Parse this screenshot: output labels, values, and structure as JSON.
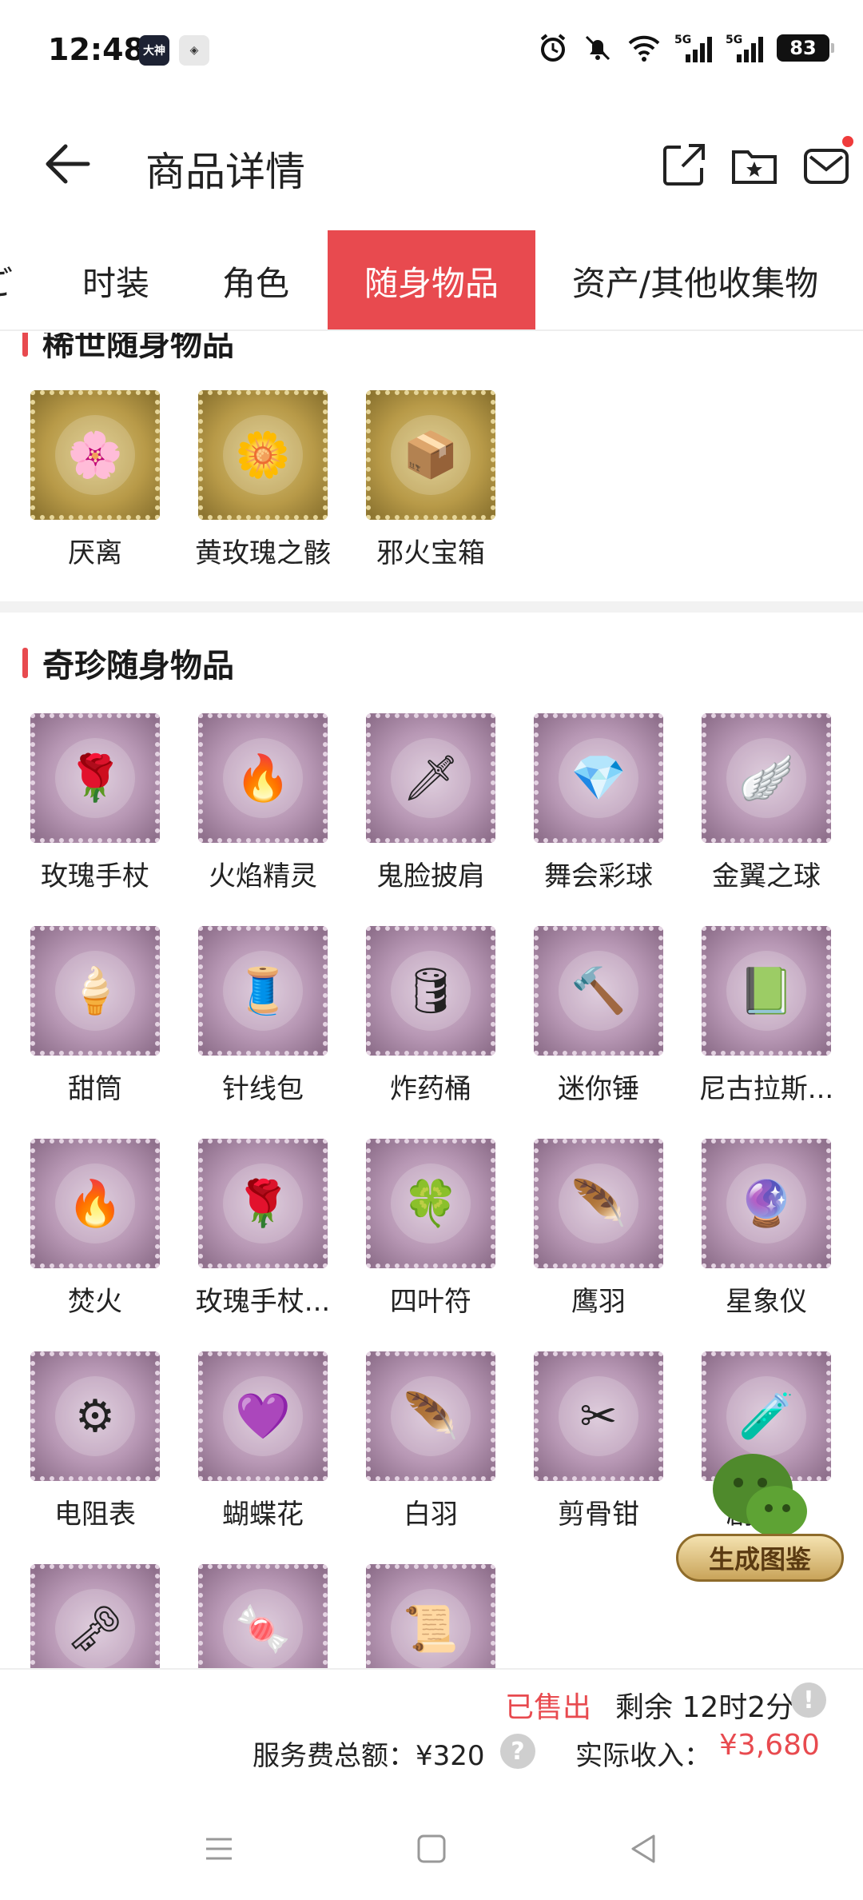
{
  "status_bar": {
    "time": "12:48",
    "app_icon_1": "大神",
    "app_icon_2": "◈",
    "battery": "83",
    "signal_1": "5G",
    "signal_2": "5G"
  },
  "header": {
    "title": "商品详情"
  },
  "tabs": [
    {
      "label": "ご",
      "active": false
    },
    {
      "label": "时装",
      "active": false
    },
    {
      "label": "角色",
      "active": false
    },
    {
      "label": "随身物品",
      "active": true
    },
    {
      "label": "资产/其他收集物",
      "active": false
    }
  ],
  "sections": {
    "rare": {
      "title": "稀世随身物品",
      "items": [
        {
          "name": "厌离",
          "emblem": "🌸"
        },
        {
          "name": "黄玫瑰之骸",
          "emblem": "🌼"
        },
        {
          "name": "邪火宝箱",
          "emblem": "📦"
        }
      ]
    },
    "precious": {
      "title": "奇珍随身物品",
      "items": [
        {
          "name": "玫瑰手杖",
          "emblem": "🌹"
        },
        {
          "name": "火焰精灵",
          "emblem": "🔥"
        },
        {
          "name": "鬼脸披肩",
          "emblem": "🗡"
        },
        {
          "name": "舞会彩球",
          "emblem": "💎"
        },
        {
          "name": "金翼之球",
          "emblem": "🪽"
        },
        {
          "name": "甜筒",
          "emblem": "🍦"
        },
        {
          "name": "针线包",
          "emblem": "🧵"
        },
        {
          "name": "炸药桶",
          "emblem": "🛢"
        },
        {
          "name": "迷你锤",
          "emblem": "🔨"
        },
        {
          "name": "尼古拉斯...",
          "emblem": "📗"
        },
        {
          "name": "焚火",
          "emblem": "🔥"
        },
        {
          "name": "玫瑰手杖...",
          "emblem": "🌹"
        },
        {
          "name": "四叶符",
          "emblem": "🍀"
        },
        {
          "name": "鹰羽",
          "emblem": "🪶"
        },
        {
          "name": "星象仪",
          "emblem": "🔮"
        },
        {
          "name": "电阻表",
          "emblem": "⚙"
        },
        {
          "name": "蝴蝶花",
          "emblem": "💜"
        },
        {
          "name": "白羽",
          "emblem": "🪶"
        },
        {
          "name": "剪骨钳",
          "emblem": "✂"
        },
        {
          "name": "剧毒...",
          "emblem": "🧪"
        },
        {
          "name": "",
          "emblem": "🗝"
        },
        {
          "name": "",
          "emblem": "🍬"
        },
        {
          "name": "",
          "emblem": "📜"
        }
      ]
    }
  },
  "fab": {
    "label": "生成图鉴"
  },
  "bottom": {
    "sold": "已售出",
    "remain": "剩余 12时2分",
    "fee": "服务费总额：¥320",
    "income_label": "实际收入：",
    "income_value": "¥3,680"
  }
}
